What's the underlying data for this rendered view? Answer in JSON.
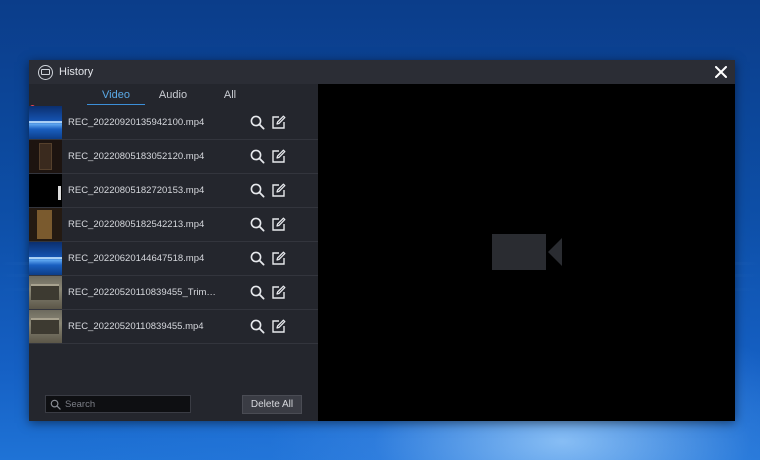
{
  "window": {
    "title": "History"
  },
  "tabs": [
    {
      "label": "Video",
      "active": true
    },
    {
      "label": "Audio",
      "active": false
    },
    {
      "label": "All",
      "active": false
    }
  ],
  "recordings": [
    {
      "name": "REC_20220920135942100.mp4",
      "thumb": "desktop"
    },
    {
      "name": "REC_20220805183052120.mp4",
      "thumb": "dark-room"
    },
    {
      "name": "REC_20220805182720153.mp4",
      "thumb": "black"
    },
    {
      "name": "REC_20220805182542213.mp4",
      "thumb": "door"
    },
    {
      "name": "REC_20220620144647518.mp4",
      "thumb": "desktop"
    },
    {
      "name": "REC_20220520110839455_Trim_0...",
      "thumb": "room"
    },
    {
      "name": "REC_20220520110839455.mp4",
      "thumb": "room"
    }
  ],
  "row_actions": {
    "search_icon": "magnifier-icon",
    "edit_icon": "edit-icon"
  },
  "search": {
    "placeholder": "Search",
    "value": ""
  },
  "delete_all_label": "Delete All",
  "preview": {
    "placeholder_icon": "video-camera-icon"
  },
  "colors": {
    "accent": "#3c8fd8",
    "panel": "#24262d",
    "preview_bg": "#000000",
    "record_dot": "#e6414f"
  }
}
